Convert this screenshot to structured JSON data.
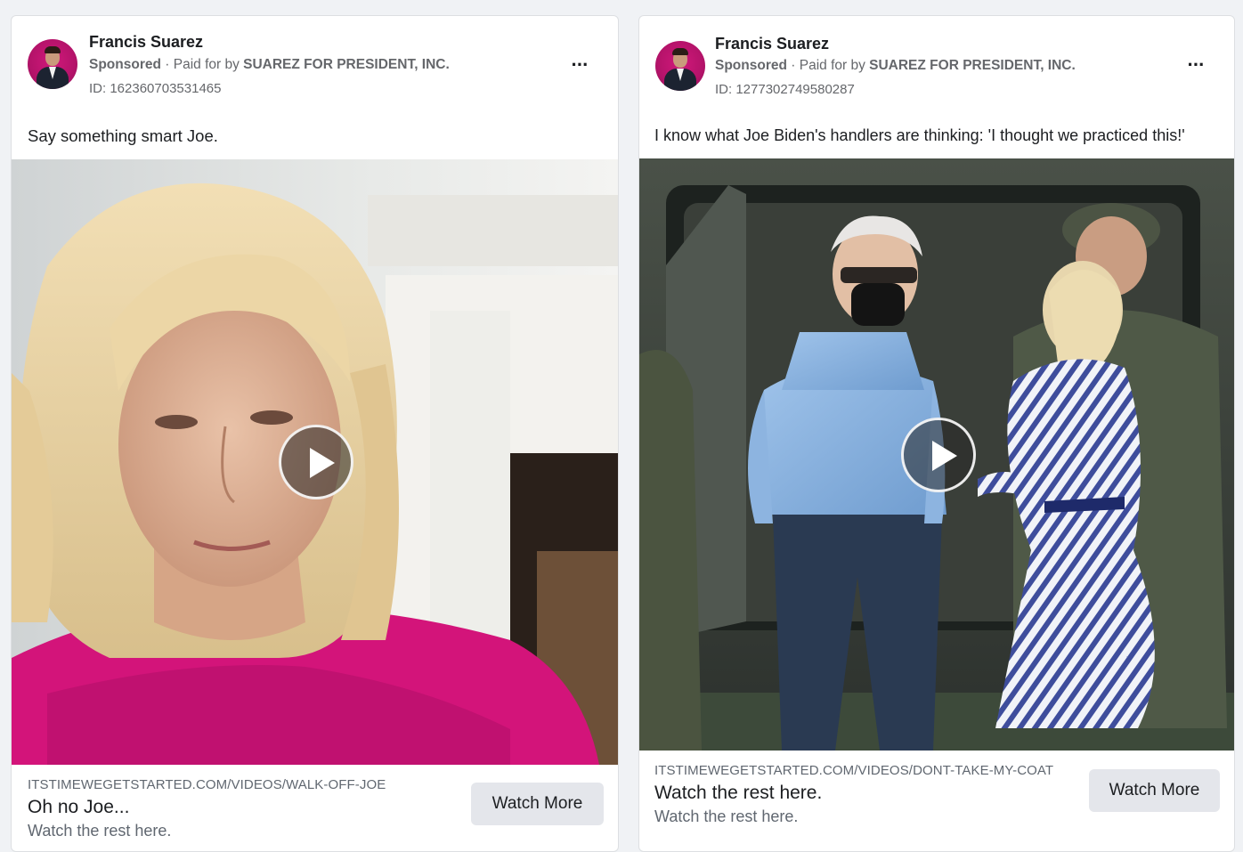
{
  "ads": [
    {
      "advertiser": "Francis Suarez",
      "sponsored_label": "Sponsored",
      "paid_for_prefix": "· Paid for by",
      "paid_for_by": "SUAREZ FOR PRESIDENT, INC.",
      "ad_id": "ID: 162360703531465",
      "more_label": "···",
      "caption": "Say something smart Joe.",
      "link_url": "ITSTIMEWEGETSTARTED.COM/VIDEOS/WALK-OFF-JOE",
      "link_title": "Oh no Joe...",
      "link_description": "Watch the rest here.",
      "cta_label": "Watch More"
    },
    {
      "advertiser": "Francis Suarez",
      "sponsored_label": "Sponsored",
      "paid_for_prefix": "· Paid for by",
      "paid_for_by": "SUAREZ FOR PRESIDENT, INC.",
      "ad_id": "ID: 1277302749580287",
      "more_label": "···",
      "caption": "I know what Joe Biden's handlers are thinking: 'I thought we practiced this!'",
      "link_url": "ITSTIMEWEGETSTARTED.COM/VIDEOS/DONT-TAKE-MY-COAT",
      "link_title": "Watch the rest here.",
      "link_description": "Watch the rest here.",
      "cta_label": "Watch More"
    }
  ]
}
